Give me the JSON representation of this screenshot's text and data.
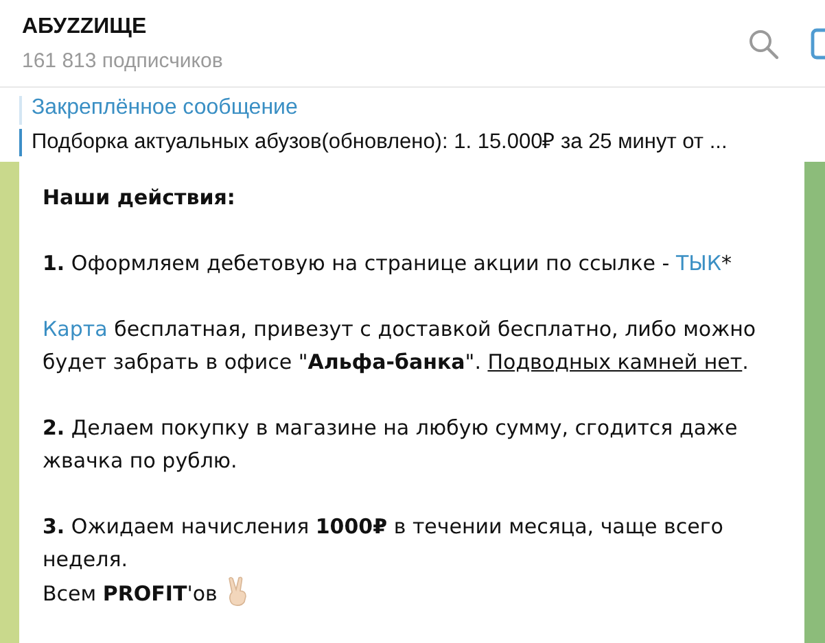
{
  "channel": {
    "title": "АБУZZИЩЕ",
    "subscribers": "161 813 подписчиков"
  },
  "pinned": {
    "label": "Закреплённое сообщение",
    "text": "Подборка актуальных абузов(обновлено):  1. 15.000₽ за 25 минут от ..."
  },
  "message": {
    "paragraphs": [
      {
        "lines": [
          {
            "bold": true,
            "parts": [
              {
                "kind": "text",
                "text": "Наши действия:"
              }
            ]
          }
        ]
      },
      {
        "lines": [
          {
            "bold": false,
            "parts": [
              {
                "kind": "text",
                "text": "**1.** Оформляем дебетовую на странице акции по ссылке - "
              },
              {
                "kind": "link",
                "text": "ТЫК"
              },
              {
                "kind": "text",
                "text": "*"
              }
            ]
          }
        ]
      },
      {
        "lines": [
          {
            "bold": false,
            "parts": [
              {
                "kind": "link",
                "text": "Карта"
              },
              {
                "kind": "text",
                "text": " бесплатная, привезут с доставкой бесплатно, либо можно будет забрать в офисе \"**Альфа-банка**\". "
              },
              {
                "kind": "underline",
                "text": "Подводных камней нет"
              },
              {
                "kind": "text",
                "text": "."
              }
            ]
          }
        ]
      },
      {
        "lines": [
          {
            "bold": false,
            "parts": [
              {
                "kind": "text",
                "text": "**2.** Делаем покупку в магазине на любую сумму, сгодится даже жвачка по рублю."
              }
            ]
          }
        ]
      },
      {
        "lines": [
          {
            "bold": false,
            "parts": [
              {
                "kind": "text",
                "text": "**3.** Ожидаем начисления **1000₽** в течении месяца, чаще всего неделя."
              }
            ]
          },
          {
            "bold": false,
            "emoji": true,
            "parts": [
              {
                "kind": "text",
                "text": "Всем **PROFIT**'ов"
              }
            ]
          }
        ]
      }
    ]
  }
}
